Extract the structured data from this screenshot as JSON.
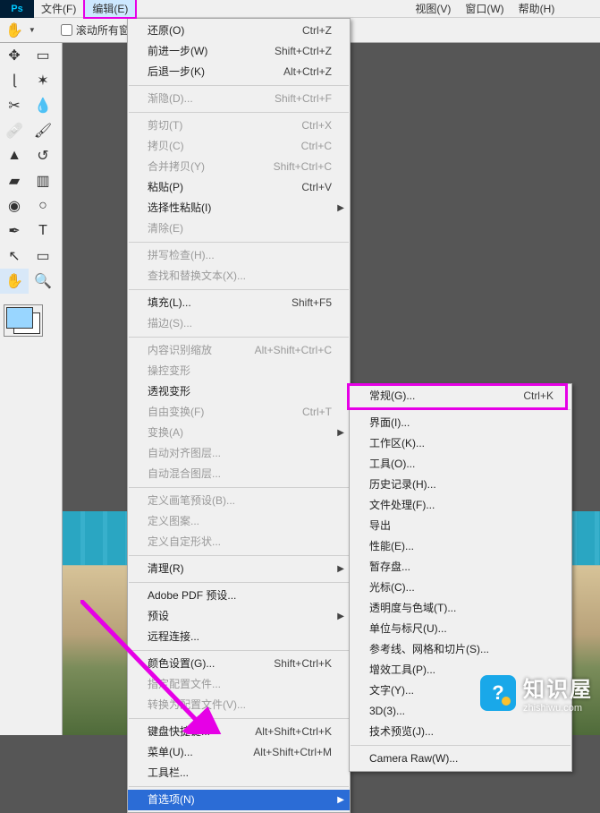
{
  "menubar": {
    "logo": "Ps",
    "items": [
      "文件(F)",
      "编辑(E)",
      "",
      "",
      "",
      "视图(V)",
      "窗口(W)",
      "帮助(H)"
    ],
    "open_index": 1
  },
  "toolbar": {
    "scroll_all": "滚动所有窗"
  },
  "edit_menu": [
    {
      "label": "还原(O)",
      "shortcut": "Ctrl+Z"
    },
    {
      "label": "前进一步(W)",
      "shortcut": "Shift+Ctrl+Z"
    },
    {
      "label": "后退一步(K)",
      "shortcut": "Alt+Ctrl+Z"
    },
    {
      "sep": true
    },
    {
      "label": "渐隐(D)...",
      "shortcut": "Shift+Ctrl+F",
      "disabled": true
    },
    {
      "sep": true
    },
    {
      "label": "剪切(T)",
      "shortcut": "Ctrl+X",
      "disabled": true
    },
    {
      "label": "拷贝(C)",
      "shortcut": "Ctrl+C",
      "disabled": true
    },
    {
      "label": "合并拷贝(Y)",
      "shortcut": "Shift+Ctrl+C",
      "disabled": true
    },
    {
      "label": "粘贴(P)",
      "shortcut": "Ctrl+V"
    },
    {
      "label": "选择性粘贴(I)",
      "submenu": true
    },
    {
      "label": "清除(E)",
      "disabled": true
    },
    {
      "sep": true
    },
    {
      "label": "拼写检查(H)...",
      "disabled": true
    },
    {
      "label": "查找和替换文本(X)...",
      "disabled": true
    },
    {
      "sep": true
    },
    {
      "label": "填充(L)...",
      "shortcut": "Shift+F5"
    },
    {
      "label": "描边(S)...",
      "disabled": true
    },
    {
      "sep": true
    },
    {
      "label": "内容识别缩放",
      "shortcut": "Alt+Shift+Ctrl+C",
      "disabled": true
    },
    {
      "label": "操控变形",
      "disabled": true
    },
    {
      "label": "透视变形"
    },
    {
      "label": "自由变换(F)",
      "shortcut": "Ctrl+T",
      "disabled": true
    },
    {
      "label": "变换(A)",
      "submenu": true,
      "disabled": true
    },
    {
      "label": "自动对齐图层...",
      "disabled": true
    },
    {
      "label": "自动混合图层...",
      "disabled": true
    },
    {
      "sep": true
    },
    {
      "label": "定义画笔预设(B)...",
      "disabled": true
    },
    {
      "label": "定义图案...",
      "disabled": true
    },
    {
      "label": "定义自定形状...",
      "disabled": true
    },
    {
      "sep": true
    },
    {
      "label": "清理(R)",
      "submenu": true
    },
    {
      "sep": true
    },
    {
      "label": "Adobe PDF 预设..."
    },
    {
      "label": "预设",
      "submenu": true
    },
    {
      "label": "远程连接..."
    },
    {
      "sep": true
    },
    {
      "label": "颜色设置(G)...",
      "shortcut": "Shift+Ctrl+K"
    },
    {
      "label": "指定配置文件...",
      "disabled": true
    },
    {
      "label": "转换为配置文件(V)...",
      "disabled": true
    },
    {
      "sep": true
    },
    {
      "label": "键盘快捷键...",
      "shortcut": "Alt+Shift+Ctrl+K"
    },
    {
      "label": "菜单(U)...",
      "shortcut": "Alt+Shift+Ctrl+M"
    },
    {
      "label": "工具栏..."
    },
    {
      "sep": true
    },
    {
      "label": "首选项(N)",
      "submenu": true,
      "highlight": true
    }
  ],
  "pref_submenu": [
    {
      "label": "常规(G)...",
      "shortcut": "Ctrl+K",
      "boxed": true
    },
    {
      "sep": true
    },
    {
      "label": "界面(I)..."
    },
    {
      "label": "工作区(K)..."
    },
    {
      "label": "工具(O)..."
    },
    {
      "label": "历史记录(H)..."
    },
    {
      "label": "文件处理(F)..."
    },
    {
      "label": "导出"
    },
    {
      "label": "性能(E)..."
    },
    {
      "label": "暂存盘..."
    },
    {
      "label": "光标(C)..."
    },
    {
      "label": "透明度与色域(T)..."
    },
    {
      "label": "单位与标尺(U)..."
    },
    {
      "label": "参考线、网格和切片(S)..."
    },
    {
      "label": "增效工具(P)..."
    },
    {
      "label": "文字(Y)..."
    },
    {
      "label": "3D(3)..."
    },
    {
      "label": "技术预览(J)..."
    },
    {
      "sep": true
    },
    {
      "label": "Camera Raw(W)..."
    }
  ],
  "watermark": {
    "title": "知识屋",
    "sub": "zhishiwu.com",
    "badge": "?"
  }
}
